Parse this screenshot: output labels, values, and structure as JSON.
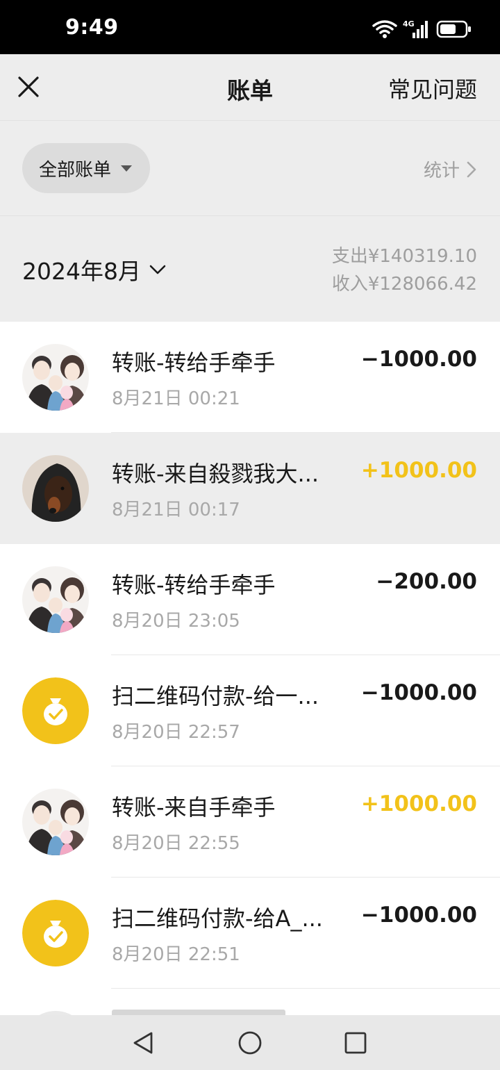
{
  "status_bar": {
    "time": "9:49",
    "network": "4G"
  },
  "nav": {
    "title": "账单",
    "faq_label": "常见问题"
  },
  "filter": {
    "label": "全部账单",
    "stats_label": "统计"
  },
  "month": {
    "label": "2024年8月",
    "expense": "支出¥140319.10",
    "income": "收入¥128066.42"
  },
  "colors": {
    "income": "#f2c21a",
    "expense": "#191919",
    "pay_icon_bg": "#f2c21a"
  },
  "records": [
    {
      "name": "转账-转给手牵手",
      "time": "8月21日 00:21",
      "amount": "−1000.00",
      "direction": "out",
      "avatar": "family-avatar-icon"
    },
    {
      "name": "转账-来自殺戮我大...",
      "time": "8月21日 00:17",
      "amount": "+1000.00",
      "direction": "in",
      "avatar": "dog-avatar-icon",
      "highlighted": true
    },
    {
      "name": "转账-转给手牵手",
      "time": "8月20日 23:05",
      "amount": "−200.00",
      "direction": "out",
      "avatar": "family-avatar-icon"
    },
    {
      "name": "扫二维码付款-给一...",
      "time": "8月20日 22:57",
      "amount": "−1000.00",
      "direction": "out",
      "avatar": "money-bag-icon"
    },
    {
      "name": "转账-来自手牵手",
      "time": "8月20日 22:55",
      "amount": "+1000.00",
      "direction": "in",
      "avatar": "family-avatar-icon"
    },
    {
      "name": "扫二维码付款-给A_...",
      "time": "8月20日 22:51",
      "amount": "−1000.00",
      "direction": "out",
      "avatar": "money-bag-icon"
    }
  ]
}
